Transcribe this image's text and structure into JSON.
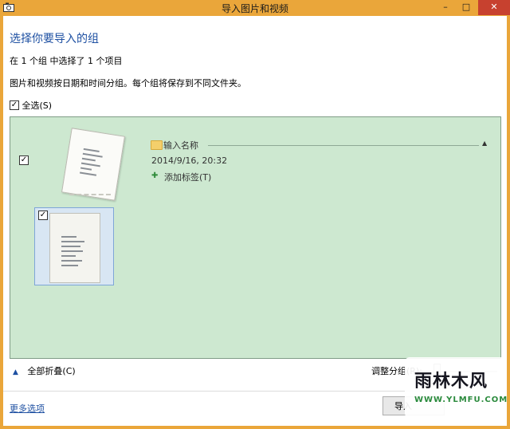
{
  "window": {
    "title": "导入图片和视频",
    "controls": {
      "minimize": "–",
      "maximize": "□",
      "close": "✕"
    }
  },
  "heading": "选择你要导入的组",
  "summary": "在 1 个组 中选择了 1 个项目",
  "description": "图片和视频按日期和时间分组。每个组将保存到不同文件夹。",
  "select_all": {
    "label": "全选(S)",
    "checked": true
  },
  "group": {
    "checked": true,
    "name": "输入名称",
    "date": "2014/9/16, 20:32",
    "add_tag": "添加标签(T)",
    "items": [
      {
        "checked": true
      }
    ]
  },
  "footer": {
    "collapse_all": "全部折叠(C)",
    "adjust_groups": "调整分组(R):",
    "more_options": "更多选项",
    "import_button": "导入"
  },
  "watermark": {
    "text": "雨林木风",
    "url": "WWW.YLMFU.COM"
  },
  "icons": {
    "app": "camera-icon",
    "folder": "folder-icon",
    "tag": "add-tag-icon",
    "collapse": "chevron-up-icon"
  },
  "colors": {
    "title_bar": "#eaa63a",
    "close_button": "#c7412f",
    "heading": "#1e50a2",
    "group_background": "#cde8d0",
    "selection_border": "#7ea6d8"
  }
}
